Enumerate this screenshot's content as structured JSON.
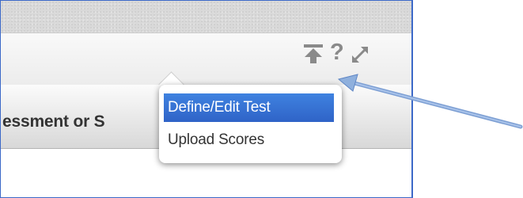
{
  "window": {
    "visible_title_fragment": "essment or S",
    "toolbar_icons": [
      "upload-icon",
      "help-icon",
      "expand-icon"
    ],
    "help_glyph": "?"
  },
  "popup_menu": {
    "items": [
      {
        "label": "Define/Edit Test",
        "selected": true
      },
      {
        "label": "Upload Scores",
        "selected": false
      }
    ]
  },
  "annotation": {
    "arrow_color": "#8fb0dd"
  }
}
